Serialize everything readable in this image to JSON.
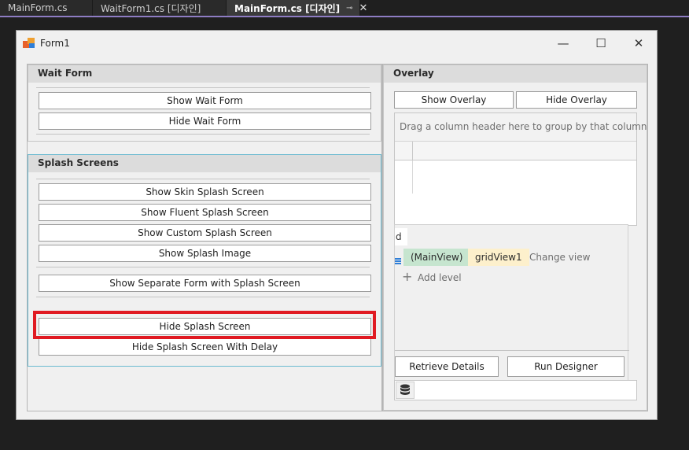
{
  "ide": {
    "tabs": [
      {
        "label": "MainForm.cs"
      },
      {
        "label": "WaitForm1.cs [디자인]"
      },
      {
        "label": "MainForm.cs [디자인]",
        "pin": "⊸",
        "close": "✕"
      }
    ],
    "accent": "#8e7cc3"
  },
  "window": {
    "title": "Form1",
    "minimize": "—",
    "maximize": "☐",
    "close": "✕"
  },
  "wait_form": {
    "header": "Wait Form",
    "show_label": "Show Wait Form",
    "hide_label": "Hide Wait Form"
  },
  "splash": {
    "header": "Splash Screens",
    "show_skin": "Show Skin Splash Screen",
    "show_fluent": "Show Fluent Splash Screen",
    "show_custom": "Show Custom Splash Screen",
    "show_image": "Show Splash Image",
    "show_separate": "Show Separate Form with Splash Screen",
    "hide": "Hide Splash Screen",
    "hide_delay": "Hide Splash Screen With Delay",
    "highlight_color": "#e01a22"
  },
  "overlay": {
    "header": "Overlay",
    "show_label": "Show Overlay",
    "hide_label": "Hide Overlay"
  },
  "grid": {
    "group_panel_text": "Drag a column header here to group by that column",
    "level_fragment": "d",
    "main_view": "(MainView)",
    "grid_view": "gridView1",
    "change_view": "Change view",
    "add_level": "Add level",
    "retrieve_details": "Retrieve Details",
    "run_designer": "Run Designer",
    "database_icon": "database-icon"
  }
}
